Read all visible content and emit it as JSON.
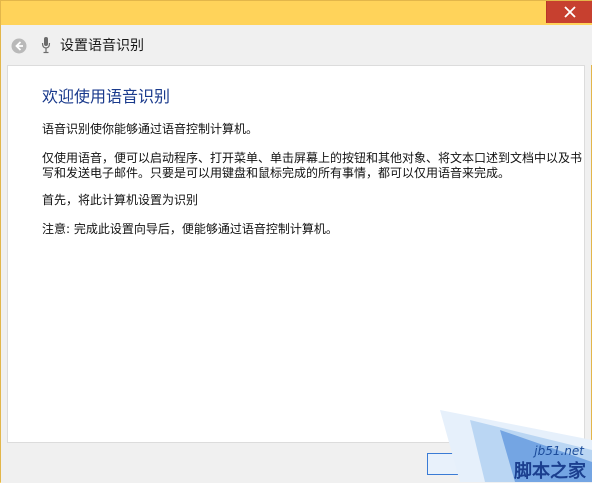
{
  "nav": {
    "title": "设置语音识别"
  },
  "content": {
    "heading": "欢迎使用语音识别",
    "p1": "语音识别使你能够通过语音控制计算机。",
    "p2_line1": "仅使用语音，便可以启动程序、打开菜单、单击屏幕上的按钮和其他对象、将文本口述到文档中以及书",
    "p2_line2": "写和发送电子邮件。只要是可以用键盘和鼠标完成的所有事情，都可以仅用语音来完成。",
    "p3": "首先，将此计算机设置为识别",
    "p4": "注意: 完成此设置向导后，便能够通过语音控制计算机。"
  },
  "watermark": {
    "site": "jb51.net",
    "name": "脚本之家"
  },
  "colors": {
    "titlebar": "#ffd35a",
    "close": "#c7402f",
    "heading": "#1a3a8c",
    "window_bg": "#f0f0f0"
  }
}
